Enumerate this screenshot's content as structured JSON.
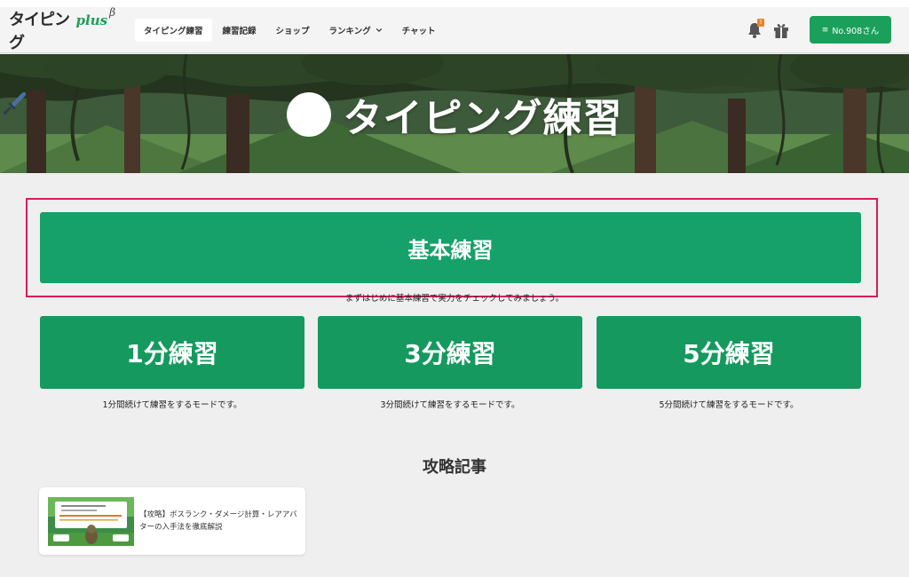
{
  "header": {
    "logo": {
      "main": "タイピング",
      "plus": "plus",
      "beta": "β"
    },
    "nav": [
      {
        "label": "タイピング練習",
        "active": true
      },
      {
        "label": "練習記録",
        "active": false
      },
      {
        "label": "ショップ",
        "active": false
      },
      {
        "label": "ランキング",
        "active": false,
        "has_dropdown": true
      },
      {
        "label": "チャット",
        "active": false
      }
    ],
    "notification_count": "!",
    "user_button": {
      "icon": "menu-icon",
      "label": "No.908さん"
    }
  },
  "hero": {
    "title": "タイピング練習",
    "icon": "sword-icon"
  },
  "practice": {
    "basic": {
      "label": "基本練習",
      "description": "まずはじめに基本練習で実力をチェックしてみましょう。"
    },
    "modes": [
      {
        "label": "1分練習",
        "description": "1分間続けて練習をするモードです。"
      },
      {
        "label": "3分練習",
        "description": "3分間続けて練習をするモードです。"
      },
      {
        "label": "5分練習",
        "description": "5分間続けて練習をするモードです。"
      }
    ]
  },
  "articles": {
    "section_title": "攻略記事",
    "items": [
      {
        "title": "【攻略】ボスランク・ダメージ計算・レアアバターの入手法を徹底解説"
      }
    ]
  },
  "colors": {
    "accent_green": "#16a06a",
    "highlight": "#d81b5a",
    "badge": "#e8852a"
  }
}
